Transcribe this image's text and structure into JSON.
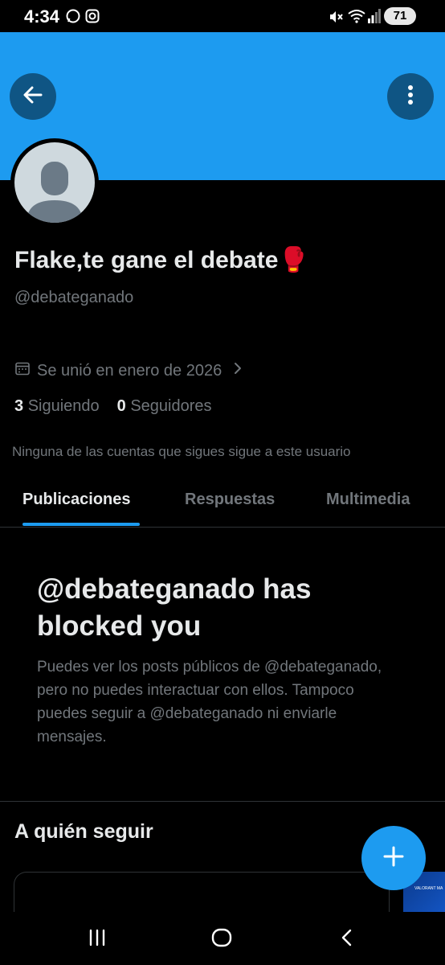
{
  "status_bar": {
    "time": "4:34",
    "battery": "71",
    "icons": [
      "whatsapp-icon",
      "instagram-icon",
      "mute-icon",
      "wifi-icon",
      "signal-icon",
      "battery-icon"
    ]
  },
  "header": {
    "back_icon": "arrow-left-icon",
    "more_icon": "more-vertical-icon",
    "banner_color": "#1d9bf0"
  },
  "profile": {
    "display_name": "Flake,te gane el debate🥊",
    "handle": "@debateganado",
    "joined": "Se unió en enero de 2026",
    "following_count": "3",
    "following_label": "Siguiendo",
    "followers_count": "0",
    "followers_label": "Seguidores",
    "mutuals_note": "Ninguna de las cuentas que sigues sigue a este usuario"
  },
  "tabs": [
    {
      "label": "Publicaciones",
      "active": true
    },
    {
      "label": "Respuestas",
      "active": false
    },
    {
      "label": "Multimedia",
      "active": false
    }
  ],
  "blocked": {
    "title": "@debateganado has blocked you",
    "description": "Puedes ver los posts públicos de @debateganado, pero no puedes interactuar con ellos. Tampoco puedes seguir a @debateganado ni enviarle mensajes."
  },
  "who_to_follow": {
    "title": "A quién seguir",
    "thumb_text": "VALORANT MA"
  },
  "fab_icon": "plus-icon",
  "nav": {
    "icons": [
      "recents-icon",
      "home-icon",
      "back-icon"
    ]
  },
  "colors": {
    "accent": "#1d9bf0",
    "background": "#000000",
    "primary_text": "#e7e9ea",
    "secondary_text": "#71767b"
  }
}
